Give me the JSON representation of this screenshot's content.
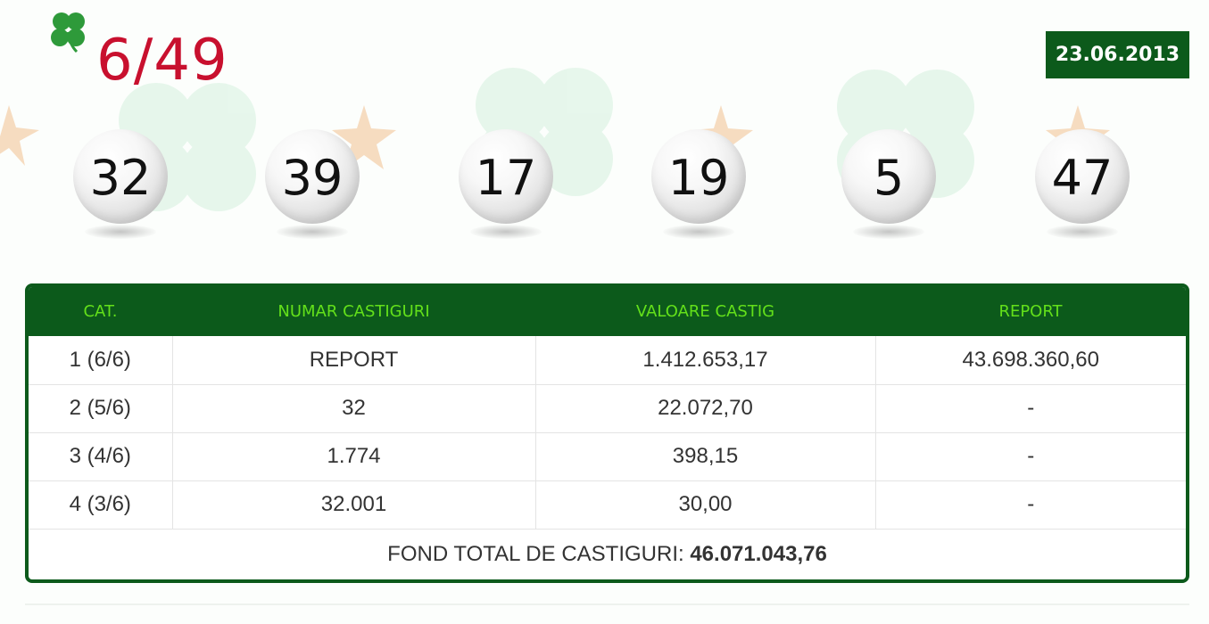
{
  "game": {
    "title": "6/49",
    "icon": "clover-icon",
    "title_color": "#c8102e"
  },
  "draw": {
    "date": "23.06.2013"
  },
  "numbers": [
    "32",
    "39",
    "17",
    "19",
    "5",
    "47"
  ],
  "table": {
    "headers": [
      "CAT.",
      "NUMAR CASTIGURI",
      "VALOARE CASTIG",
      "REPORT"
    ],
    "rows": [
      [
        "1 (6/6)",
        "REPORT",
        "1.412.653,17",
        "43.698.360,60"
      ],
      [
        "2 (5/6)",
        "32",
        "22.072,70",
        "-"
      ],
      [
        "3 (4/6)",
        "1.774",
        "398,15",
        "-"
      ],
      [
        "4 (3/6)",
        "32.001",
        "30,00",
        "-"
      ]
    ],
    "fund_label": "FOND TOTAL DE CASTIGURI:",
    "fund_value": "46.071.043,76"
  },
  "colors": {
    "accent_green": "#0c5a1b",
    "header_text": "#63e01a",
    "title_red": "#c8102e"
  }
}
